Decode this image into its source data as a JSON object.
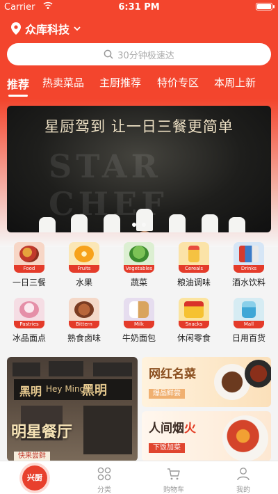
{
  "status_bar": {
    "carrier": "Carrier",
    "time": "6:31 PM"
  },
  "location": {
    "name": "众库科技"
  },
  "search": {
    "placeholder": "30分钟极速达"
  },
  "tabs": [
    {
      "label": "推荐",
      "active": true
    },
    {
      "label": "热卖菜品",
      "active": false
    },
    {
      "label": "主厨推荐",
      "active": false
    },
    {
      "label": "特价专区",
      "active": false
    },
    {
      "label": "本周上新",
      "active": false
    }
  ],
  "banner": {
    "headline": "星厨驾到  让一日三餐更简单",
    "watermark": "STAR CHEF",
    "page_count": 2,
    "current_page": 1
  },
  "categories": [
    {
      "label": "一日三餐",
      "tag": "Food",
      "icon": "food-icon",
      "color": "#f7d6c6"
    },
    {
      "label": "水果",
      "tag": "Fruits",
      "icon": "fruit-icon",
      "color": "#fbe7b6"
    },
    {
      "label": "蔬菜",
      "tag": "Vegetables",
      "icon": "vegetable-icon",
      "color": "#dcefd2"
    },
    {
      "label": "粮油调味",
      "tag": "Cereals",
      "icon": "oil-icon",
      "color": "#fbe3a8"
    },
    {
      "label": "酒水饮料",
      "tag": "Drinks",
      "icon": "drink-icon",
      "color": "#d6e6f6"
    },
    {
      "label": "冰品面点",
      "tag": "Pastries",
      "icon": "pastry-icon",
      "color": "#f5dde4"
    },
    {
      "label": "熟食卤味",
      "tag": "Bittern",
      "icon": "braised-food-icon",
      "color": "#f4d8c8"
    },
    {
      "label": "牛奶面包",
      "tag": "Milk",
      "icon": "milk-bread-icon",
      "color": "#e6ddef"
    },
    {
      "label": "休闲零食",
      "tag": "Snacks",
      "icon": "snack-icon",
      "color": "#fbe4a0"
    },
    {
      "label": "日用百货",
      "tag": "Mall",
      "icon": "daily-goods-icon",
      "color": "#d6ecf3"
    }
  ],
  "promos": {
    "left": {
      "sign_big": "黑明",
      "sign_small": "Hey Ming",
      "title": "明星餐厅",
      "badge": "快来尝鲜"
    },
    "right_top": {
      "title": "网红名菜",
      "badge": "爆品鲜尝"
    },
    "right_bottom": {
      "title": "人间烟",
      "title_fire": "火",
      "badge": "下饭加菜"
    }
  },
  "tabbar": [
    {
      "label": "",
      "logo": "兴厨",
      "icon": "home-logo-icon"
    },
    {
      "label": "分类",
      "icon": "grid-icon"
    },
    {
      "label": "购物车",
      "icon": "cart-icon"
    },
    {
      "label": "我的",
      "icon": "user-icon"
    }
  ],
  "colors": {
    "accent": "#f3452d",
    "badge_red": "#e43b2a"
  }
}
